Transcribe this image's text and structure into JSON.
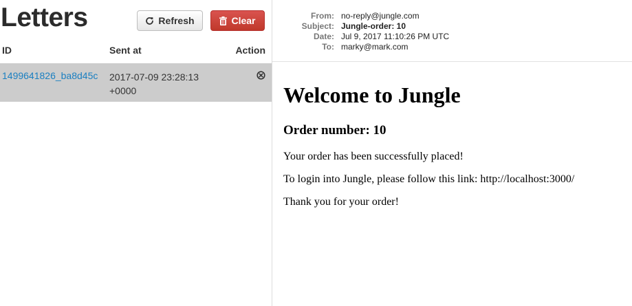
{
  "sidebar": {
    "title": "Letters",
    "refresh_label": "Refresh",
    "clear_label": "Clear",
    "table": {
      "headers": {
        "id": "ID",
        "sent_at": "Sent at",
        "action": "Action"
      },
      "rows": [
        {
          "id": "1499641826_ba8d45c",
          "sent_at": "2017-07-09 23:28:13 +0000",
          "selected": true
        }
      ]
    }
  },
  "email": {
    "headers": {
      "from_label": "From:",
      "from": "no-reply@jungle.com",
      "subject_label": "Subject:",
      "subject": "Jungle-order: 10",
      "date_label": "Date:",
      "date": "Jul 9, 2017 11:10:26 PM UTC",
      "to_label": "To:",
      "to": "marky@mark.com"
    },
    "body": {
      "heading": "Welcome to Jungle",
      "subheading": "Order number: 10",
      "paragraphs": [
        "Your order has been successfully placed!",
        "To login into Jungle, please follow this link: http://localhost:3000/",
        "Thank you for your order!"
      ]
    }
  },
  "icons": {
    "refresh": "refresh-icon",
    "clear": "trash-icon",
    "delete": "remove-circle-icon"
  },
  "colors": {
    "accent_link": "#1a7fc1",
    "danger": "#c9302c",
    "selected_row": "#cccccc"
  }
}
